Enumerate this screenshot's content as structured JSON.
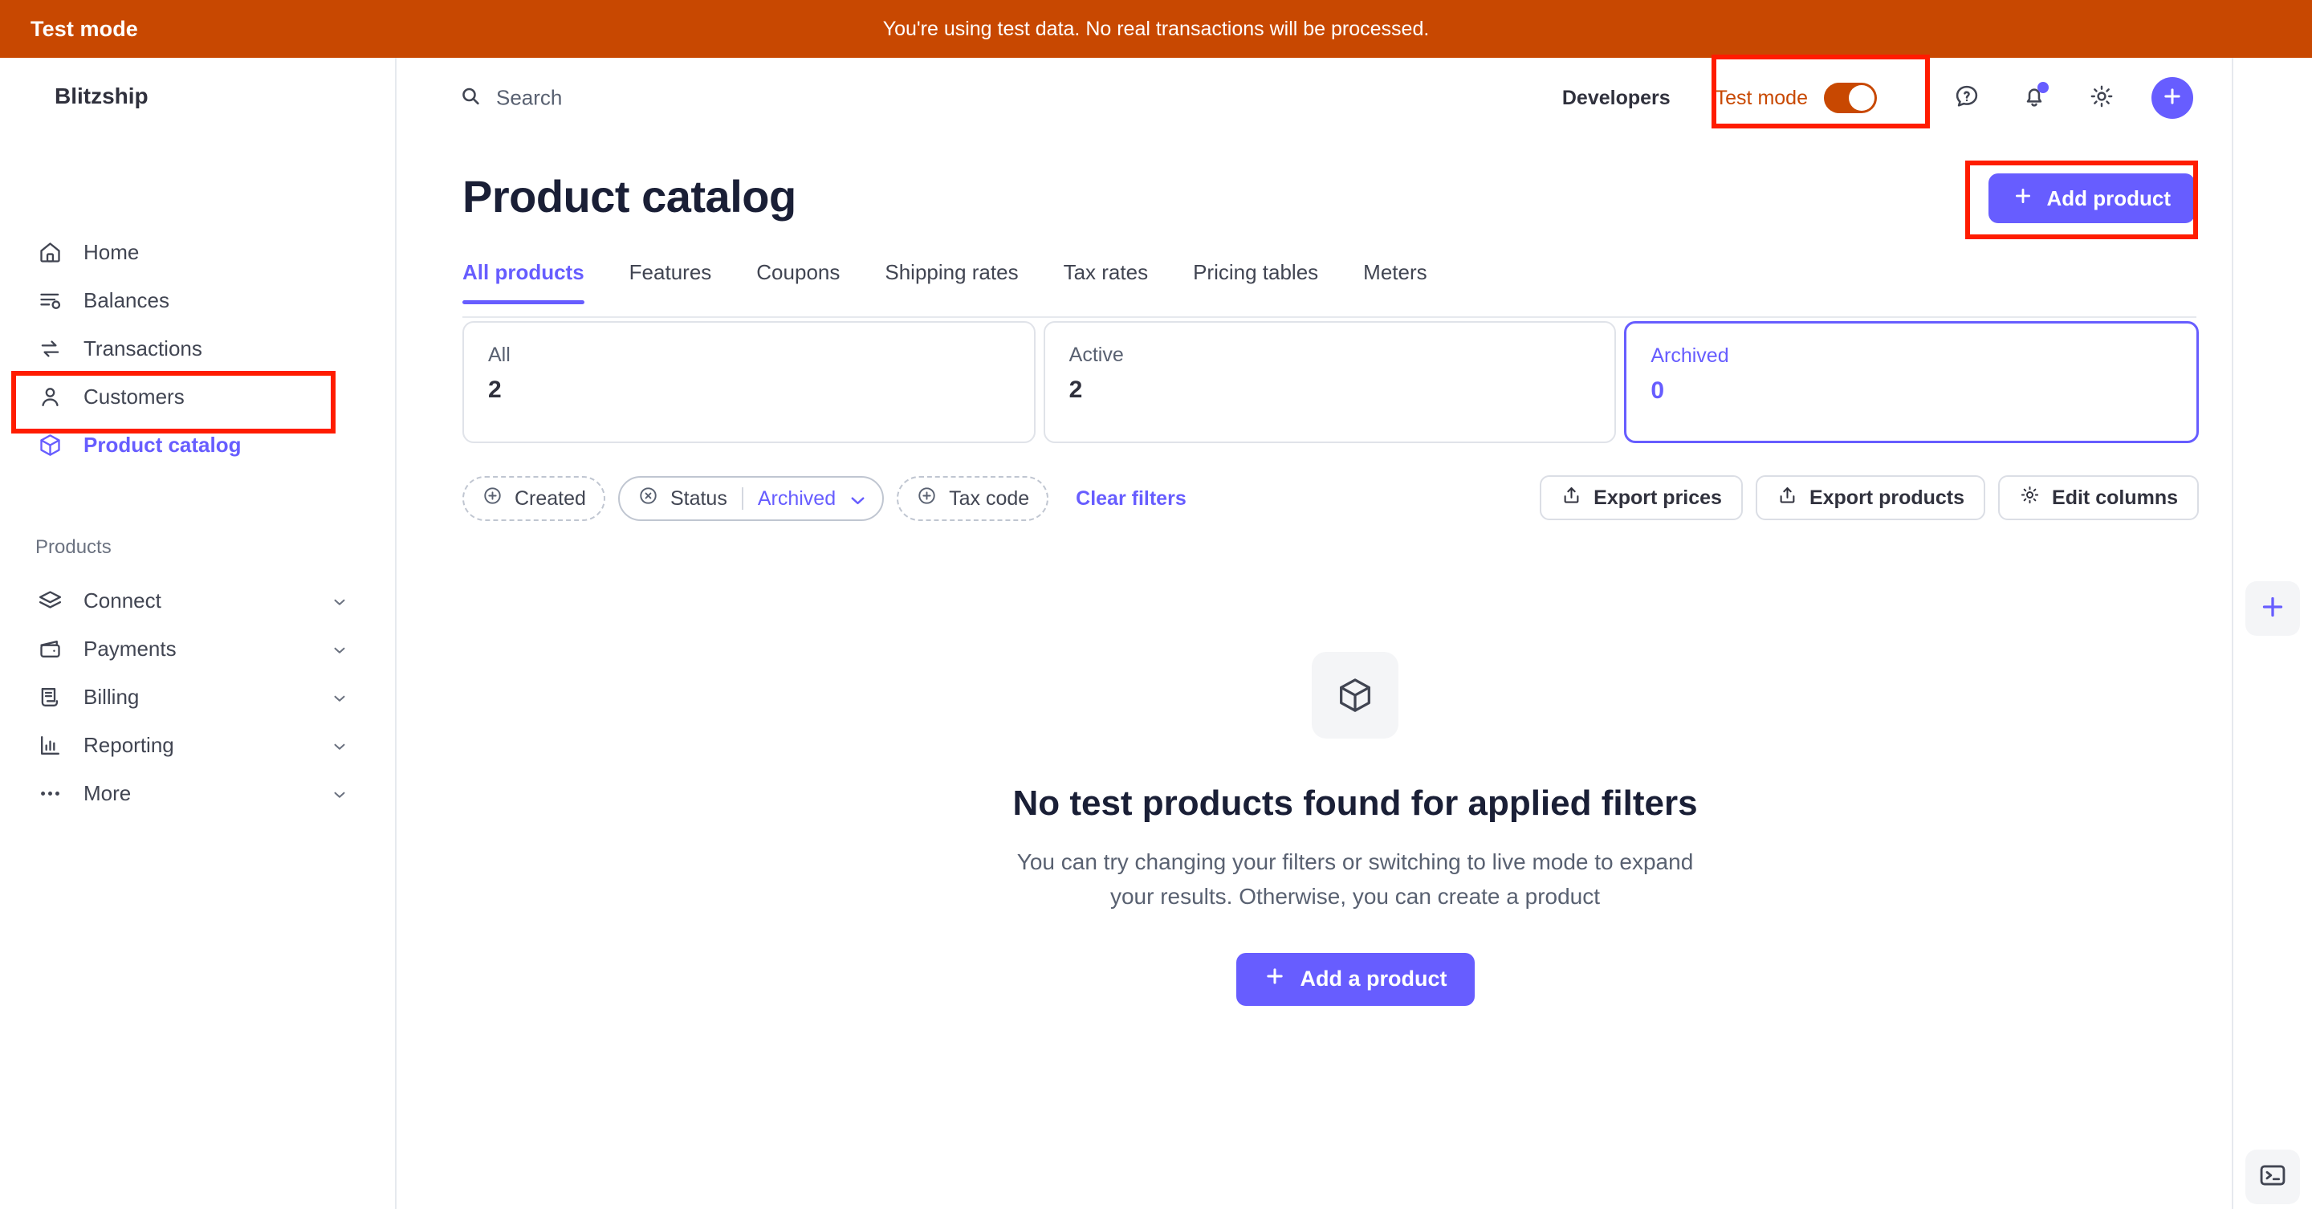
{
  "banner": {
    "label": "Test mode",
    "message": "You're using test data. No real transactions will be processed.",
    "bg_color": "#c84801"
  },
  "sidebar": {
    "brand": "Blitzship",
    "brand_icon": "storefront-icon",
    "primary_items": [
      {
        "label": "Home",
        "icon": "home-icon",
        "active": false
      },
      {
        "label": "Balances",
        "icon": "balances-icon",
        "active": false
      },
      {
        "label": "Transactions",
        "icon": "transactions-icon",
        "active": false
      },
      {
        "label": "Customers",
        "icon": "customers-icon",
        "active": false
      },
      {
        "label": "Product catalog",
        "icon": "product-catalog-icon",
        "active": true
      }
    ],
    "section_title": "Products",
    "product_items": [
      {
        "label": "Connect",
        "icon": "connect-icon"
      },
      {
        "label": "Payments",
        "icon": "payments-icon"
      },
      {
        "label": "Billing",
        "icon": "billing-icon"
      },
      {
        "label": "Reporting",
        "icon": "reporting-icon"
      },
      {
        "label": "More",
        "icon": "more-icon"
      }
    ],
    "active_color": "#675dff"
  },
  "topbar": {
    "search_placeholder": "Search",
    "search_icon": "search-icon",
    "developers_label": "Developers",
    "test_mode_label": "Test mode",
    "test_mode_on": true,
    "help_icon": "help-icon",
    "notifications_icon": "bell-icon",
    "settings_icon": "gear-icon",
    "add_icon": "plus-icon"
  },
  "page": {
    "title": "Product catalog",
    "add_product_label": "Add product",
    "add_product_icon": "plus-icon"
  },
  "tabs": [
    {
      "label": "All products",
      "active": true
    },
    {
      "label": "Features",
      "active": false
    },
    {
      "label": "Coupons",
      "active": false
    },
    {
      "label": "Shipping rates",
      "active": false
    },
    {
      "label": "Tax rates",
      "active": false
    },
    {
      "label": "Pricing tables",
      "active": false
    },
    {
      "label": "Meters",
      "active": false
    }
  ],
  "stat_cards": [
    {
      "label": "All",
      "value": "2",
      "selected": false
    },
    {
      "label": "Active",
      "value": "2",
      "selected": false
    },
    {
      "label": "Archived",
      "value": "0",
      "selected": true
    }
  ],
  "filters": {
    "created": {
      "label": "Created",
      "icon": "plus-circle-icon"
    },
    "status": {
      "label": "Status",
      "value": "Archived",
      "icon": "remove-circle-icon",
      "chevron": "chevron-down-icon"
    },
    "tax_code": {
      "label": "Tax code",
      "icon": "plus-circle-icon"
    },
    "clear_label": "Clear filters"
  },
  "actions": [
    {
      "label": "Export prices",
      "icon": "export-icon"
    },
    {
      "label": "Export products",
      "icon": "export-icon"
    },
    {
      "label": "Edit columns",
      "icon": "gear-icon"
    }
  ],
  "empty_state": {
    "icon": "package-icon",
    "title": "No test products found for applied filters",
    "description": "You can try changing your filters or switching to live mode to expand your results. Otherwise, you can create a product",
    "button_label": "Add a product",
    "button_icon": "plus-icon"
  },
  "right_rail": {
    "add_icon": "plus-icon",
    "terminal_icon": "terminal-icon"
  },
  "colors": {
    "accent": "#675dff",
    "test_orange": "#c84801",
    "annotation": "#ff1c00"
  }
}
